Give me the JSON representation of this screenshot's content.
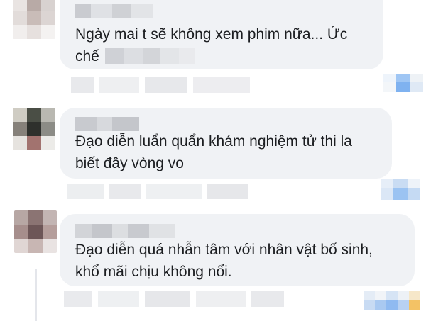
{
  "comments": [
    {
      "text": "Ngày mai t sẽ không xem phim nữa... Ức\nchế"
    },
    {
      "text": "Đạo diễn luẩn quẩn khám nghiệm tử thi la\nbiết đây vòng vo"
    },
    {
      "text": "Đạo diễn quá nhẫn tâm với nhân vật bố sinh,\nkhổ mãi chịu không nổi."
    }
  ],
  "colors": {
    "bubble": "#f0f2f5",
    "text": "#1c1e21",
    "reaction_like": "#7fb2f0",
    "reaction_haha": "#f3c265"
  }
}
